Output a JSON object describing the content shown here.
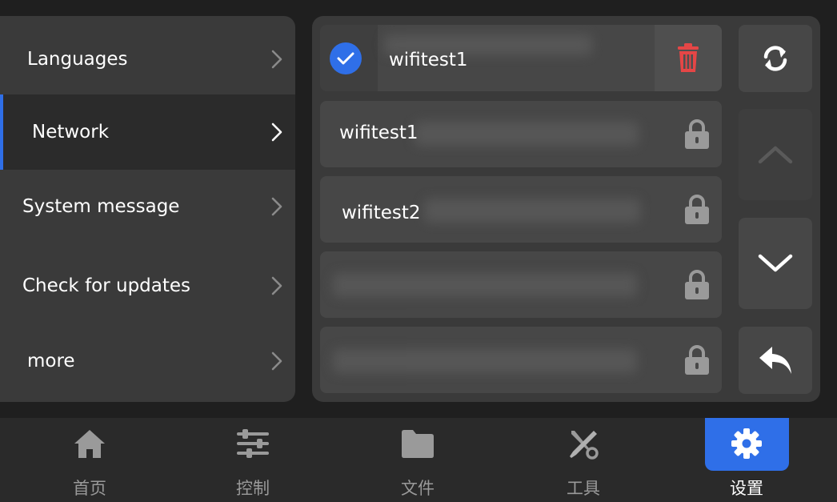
{
  "menu": {
    "items": [
      {
        "label": "Languages"
      },
      {
        "label": "Network"
      },
      {
        "label": "System message"
      },
      {
        "label": "Check for updates"
      },
      {
        "label": "more"
      }
    ]
  },
  "wifi": {
    "rows": [
      {
        "name": "wifitest1",
        "connected": true
      },
      {
        "name": "wifitest1",
        "connected": false
      },
      {
        "name": "wifitest2",
        "connected": false
      },
      {
        "name": "",
        "connected": false
      },
      {
        "name": "",
        "connected": false
      }
    ]
  },
  "controls": {
    "refresh_icon": "refresh-icon",
    "up_icon": "chevron-up-icon",
    "down_icon": "chevron-down-icon",
    "back_icon": "back-arrow-icon"
  },
  "nav": {
    "items": [
      {
        "label": "首页",
        "icon": "home-icon"
      },
      {
        "label": "控制",
        "icon": "sliders-icon"
      },
      {
        "label": "文件",
        "icon": "folder-icon"
      },
      {
        "label": "工具",
        "icon": "tools-icon"
      },
      {
        "label": "设置",
        "icon": "gear-icon",
        "active": true
      }
    ]
  },
  "colors": {
    "accent": "#2f6fe8",
    "delete": "#e54646",
    "panel": "#3a3a3a",
    "row": "#474747"
  }
}
